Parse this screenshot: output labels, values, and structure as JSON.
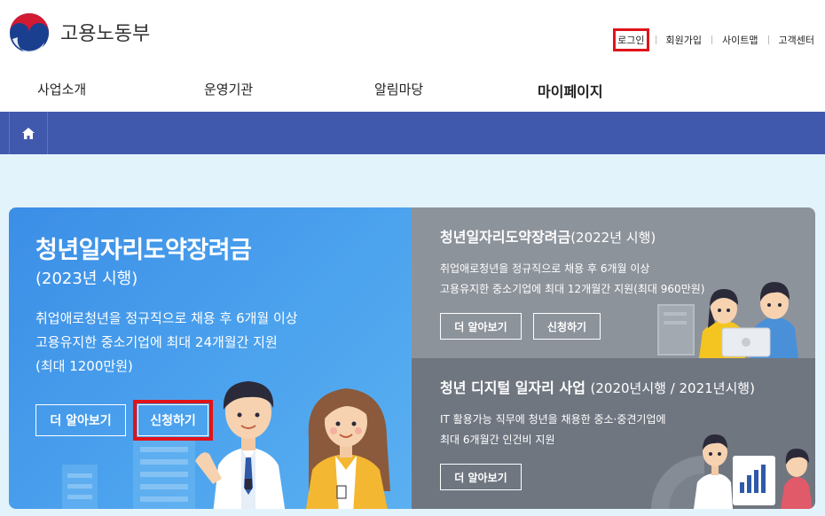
{
  "header": {
    "brand": "고용노동부",
    "util": {
      "login": "로그인",
      "signup": "회원가입",
      "sitemap": "사이트맵",
      "help": "고객센터"
    }
  },
  "gnb": {
    "items": [
      "사업소개",
      "운영기관",
      "알림마당",
      "마이페이지"
    ]
  },
  "main_card": {
    "title": "청년일자리도약장려금",
    "sub": "(2023년 시행)",
    "desc1": "취업애로청년을 정규직으로 채용 후 6개월 이상",
    "desc2": "고용유지한 중소기업에 최대 24개월간 지원",
    "desc3": "(최대 1200만원)",
    "more": "더 알아보기",
    "apply": "신청하기"
  },
  "card_top": {
    "title": "청년일자리도약장려금",
    "title_suffix": "(2022년 시행)",
    "desc1": "취업애로청년을 정규직으로 채용 후 6개월 이상",
    "desc2": "고용유지한 중소기업에 최대 12개월간 지원(최대 960만원)",
    "more": "더 알아보기",
    "apply": "신청하기"
  },
  "card_bot": {
    "title": "청년 디지털 일자리 사업",
    "title_suffix": "(2020년시행 / 2021년시행)",
    "desc1": "IT 활용가능 직무에 청년을 채용한 중소·중견기업에",
    "desc2": "최대 6개월간 인건비 지원",
    "more": "더 알아보기"
  },
  "colors": {
    "breadcrumb_bar": "#4159ad",
    "main_card": "#4da4ee",
    "card_top": "#8d939b",
    "card_bot": "#6f7680",
    "highlight": "#e0131a",
    "content_bg": "#e3f3fb"
  },
  "icons": {
    "logo": "taegeuk-logo-icon",
    "home": "home-icon"
  }
}
